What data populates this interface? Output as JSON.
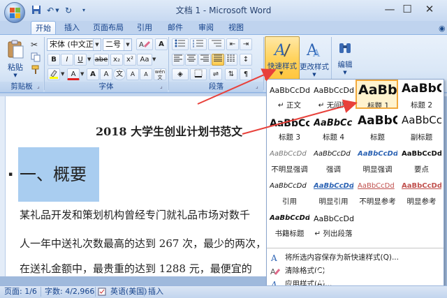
{
  "window": {
    "title": "文档 1 - Microsoft Word"
  },
  "tabs": [
    {
      "label": "开始"
    },
    {
      "label": "插入"
    },
    {
      "label": "页面布局"
    },
    {
      "label": "引用"
    },
    {
      "label": "邮件"
    },
    {
      "label": "审阅"
    },
    {
      "label": "视图"
    }
  ],
  "ribbon": {
    "clipboard": {
      "paste_label": "粘贴",
      "group_label": "剪贴板"
    },
    "font": {
      "font_name": "宋体 (中文正文",
      "font_size": "二号",
      "group_label": "字体",
      "bold": "B",
      "italic": "I",
      "underline": "U",
      "strike": "abe",
      "sub": "x₂",
      "sup": "x²",
      "aa": "Aa",
      "font_color": "A",
      "grow": "A",
      "shrink": "A",
      "char_a": "A",
      "wen": "文",
      "pinyin": "wén"
    },
    "paragraph": {
      "group_label": "段落"
    },
    "styles": {
      "quick_styles_label": "快速样式",
      "change_styles_label": "更改样式"
    },
    "editing": {
      "label": "编辑"
    }
  },
  "gallery": {
    "styles": [
      {
        "preview": "AaBbCcDd",
        "name": "↵ 正文"
      },
      {
        "preview": "AaBbCcDd",
        "name": "↵ 无间隔"
      },
      {
        "preview": "AaBb",
        "name": "标题 1"
      },
      {
        "preview": "AaBbC",
        "name": "标题 2"
      },
      {
        "preview": "AaBbCc",
        "name": "标题 3"
      },
      {
        "preview": "AaBbCc",
        "name": "标题 4"
      },
      {
        "preview": "AaBbC",
        "name": "标题"
      },
      {
        "preview": "AaBbCcl",
        "name": "副标题"
      },
      {
        "preview": "AaBbCcDd",
        "name": "不明显强调"
      },
      {
        "preview": "AaBbCcDd",
        "name": "强调"
      },
      {
        "preview": "AaBbCcDd",
        "name": "明显强调"
      },
      {
        "preview": "AaBbCcDd",
        "name": "要点"
      },
      {
        "preview": "AaBbCcDd",
        "name": "引用"
      },
      {
        "preview": "AaBbCcDd",
        "name": "明显引用"
      },
      {
        "preview": "AaBbCcDd",
        "name": "不明显参考"
      },
      {
        "preview": "AaBbCcDd",
        "name": "明显参考"
      },
      {
        "preview": "AaBbCcDd",
        "name": "书籍标题"
      },
      {
        "preview": "AaBbCcDd",
        "name": "↵ 列出段落"
      }
    ],
    "menu": [
      {
        "label": "将所选内容保存为新快速样式(Q)..."
      },
      {
        "label": "清除格式(C)"
      },
      {
        "label": "应用样式(A)..."
      }
    ]
  },
  "document": {
    "title": "2018 大学生创业计划书范文",
    "heading": "一、概要",
    "lines": [
      "某礼品开发和策划机构曾经专门就礼品市场对数千",
      "人一年中送礼次数最高的达到 267 次，最少的两次，",
      "在送礼金额中，最贵重的达到 1288 元，最便宜的"
    ]
  },
  "status": {
    "page": "页面: 1/6",
    "words": "字数: 4/2,966",
    "language": "英语(美国)",
    "mode": "插入"
  },
  "watermark": "软件SOS"
}
